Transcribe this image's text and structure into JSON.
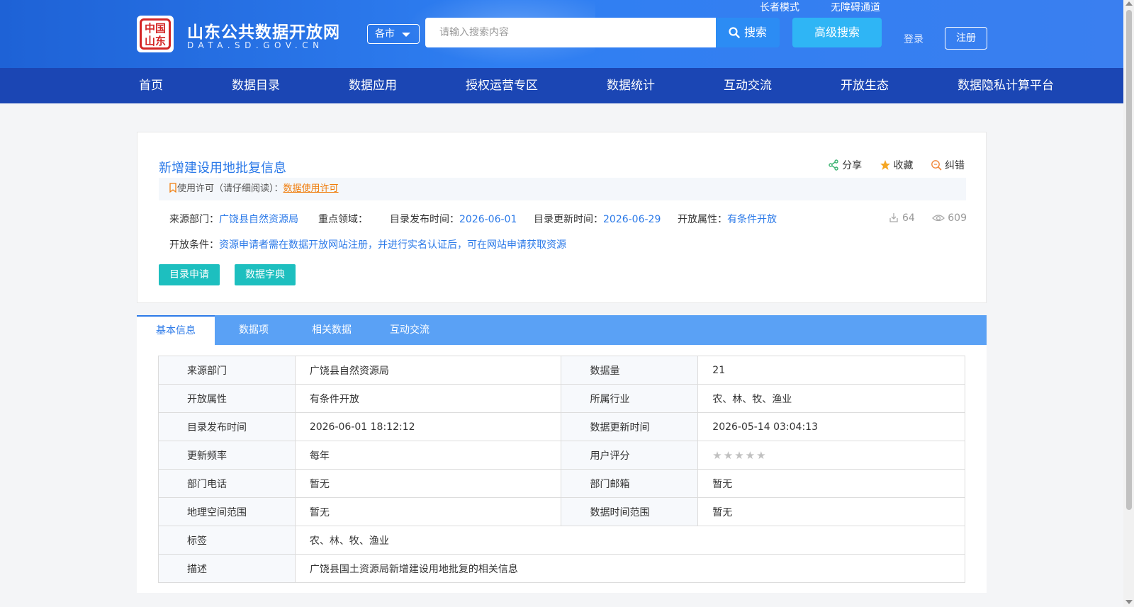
{
  "header": {
    "logo_seal_text": "中国山东",
    "site_name": "山东公共数据开放网",
    "site_domain": "DATA.SD.GOV.CN",
    "city_select": "各市",
    "search_placeholder": "请输入搜索内容",
    "search_button": "搜索",
    "advanced_search": "高级搜索",
    "elder_mode": "长者模式",
    "accessibility": "无障碍通道",
    "login": "登录",
    "register": "注册"
  },
  "nav": [
    "首页",
    "数据目录",
    "数据应用",
    "授权运营专区",
    "数据统计",
    "互动交流",
    "开放生态",
    "数据隐私计算平台"
  ],
  "detail": {
    "title": "新增建设用地批复信息",
    "share": "分享",
    "favorite": "收藏",
    "report": "纠错",
    "license_label": "使用许可（请仔细阅读）：",
    "license_link": "数据使用许可",
    "source_label": "来源部门：",
    "source_value": "广饶县自然资源局",
    "focus_label": "重点领域：",
    "publish_label": "目录发布时间：",
    "publish_value": "2026-06-01",
    "update_label": "目录更新时间：",
    "update_value": "2026-06-29",
    "open_label": "开放属性：",
    "open_value": "有条件开放",
    "downloads": "64",
    "views": "609",
    "condition_label": "开放条件：",
    "condition_value": "资源申请者需在数据开放网站注册，并进行实名认证后，可在网站申请获取资源",
    "apply_button": "目录申请",
    "dictionary_button": "数据字典"
  },
  "tabs": [
    "基本信息",
    "数据项",
    "相关数据",
    "互动交流"
  ],
  "info_table": {
    "rows": [
      {
        "k1": "来源部门",
        "v1": "广饶县自然资源局",
        "k2": "数据量",
        "v2": "21"
      },
      {
        "k1": "开放属性",
        "v1": "有条件开放",
        "k2": "所属行业",
        "v2": "农、林、牧、渔业"
      },
      {
        "k1": "目录发布时间",
        "v1": "2026-06-01 18:12:12",
        "k2": "数据更新时间",
        "v2": "2026-05-14 03:04:13"
      },
      {
        "k1": "更新频率",
        "v1": "每年",
        "k2": "用户评分",
        "v2": ""
      },
      {
        "k1": "部门电话",
        "v1": "暂无",
        "k2": "部门邮箱",
        "v2": "暂无"
      },
      {
        "k1": "地理空间范围",
        "v1": "暂无",
        "k2": "数据时间范围",
        "v2": "暂无"
      }
    ],
    "tag_label": "标签",
    "tag_value": "农、林、牧、渔业",
    "desc_label": "描述",
    "desc_value": "广饶县国土资源局新增建设用地批复的相关信息",
    "rating_stars": 0,
    "rating_max": 5
  },
  "colors": {
    "header_gradient_start": "#1e62d6",
    "nav_bg": "#1b46b4",
    "link_blue": "#2c7ae8",
    "teal_button": "#1dbfbf",
    "tab_bar": "#5aa1f5",
    "license_orange": "#f07d0c"
  }
}
